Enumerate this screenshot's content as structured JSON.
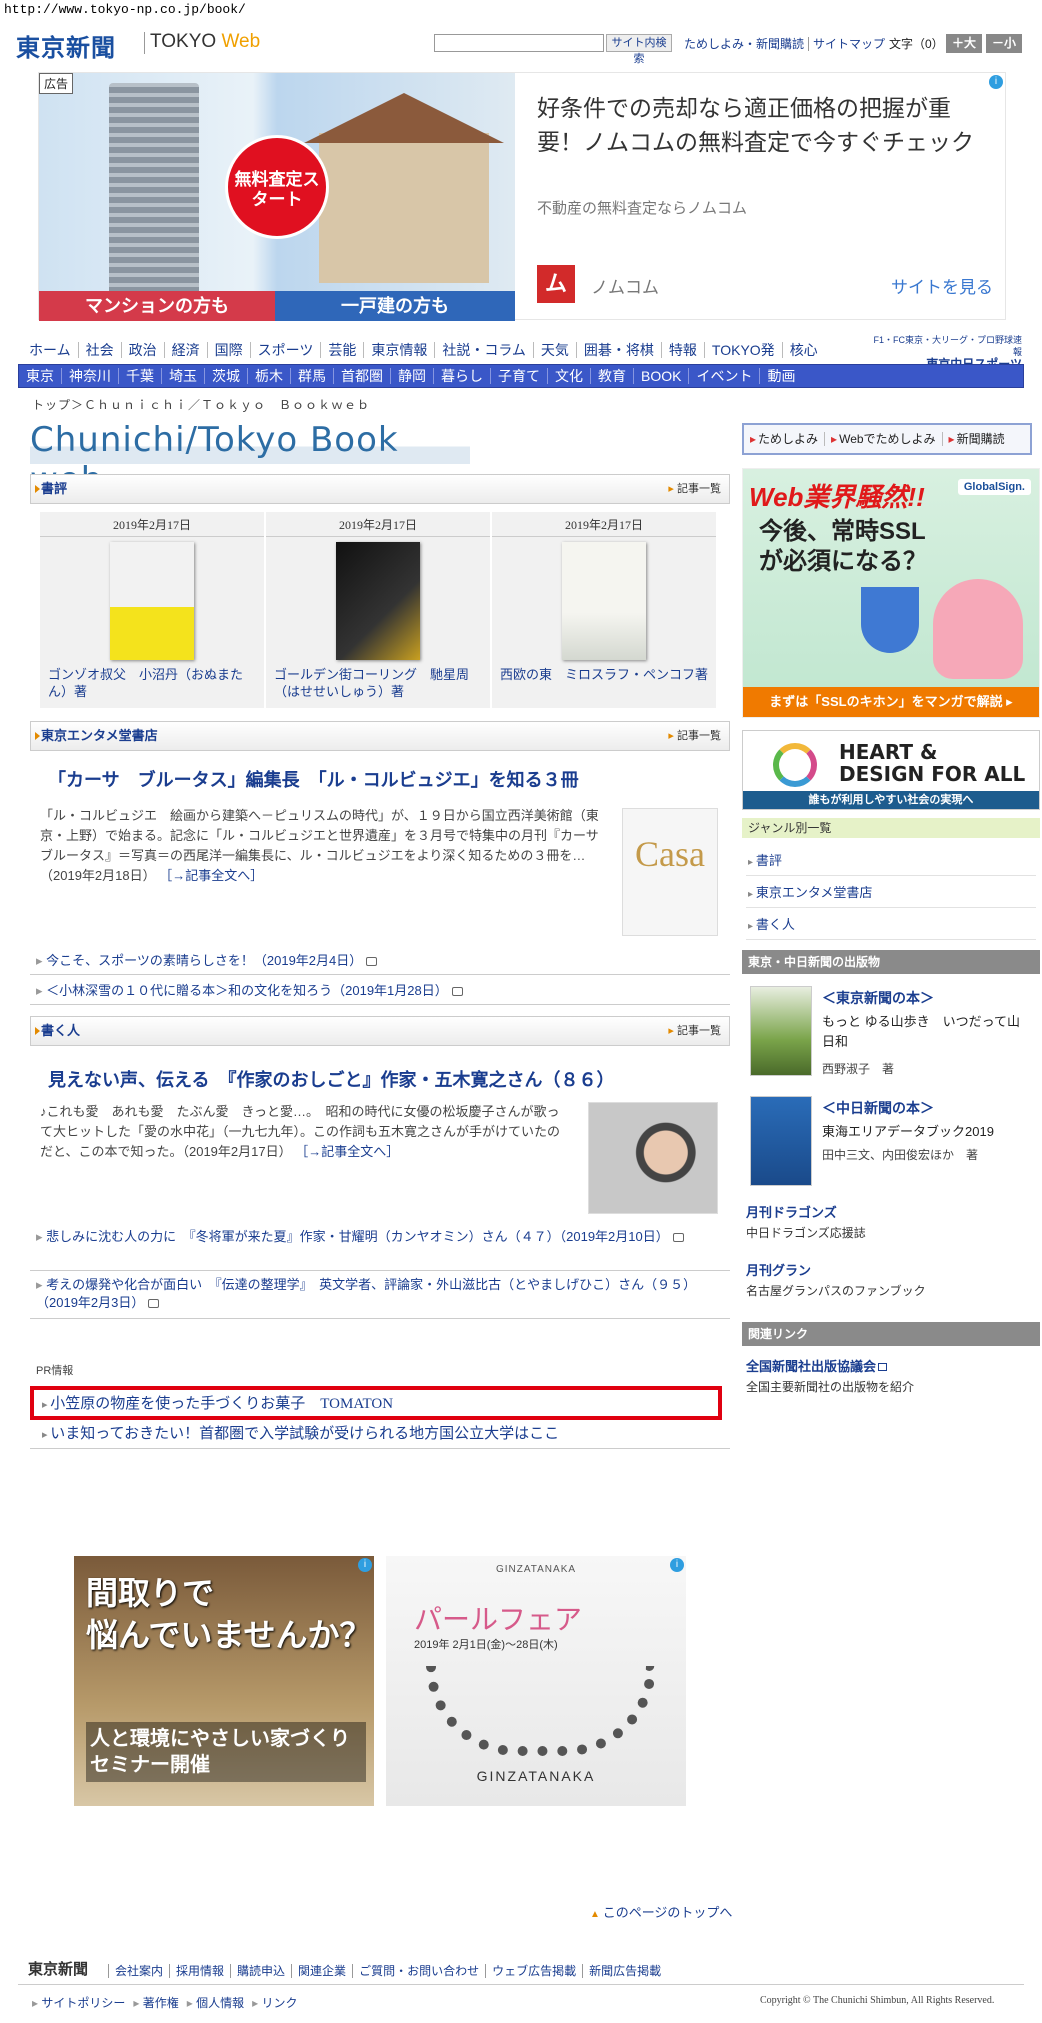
{
  "url": "http://www.tokyo-np.co.jp/book/",
  "header": {
    "logo": "東京新聞",
    "logo_web_prefix": "TOKYO",
    "logo_web_suffix": "Web",
    "search_button": "サイト内検索",
    "links": [
      "ためしよみ・新聞購読",
      "サイトマップ"
    ],
    "text_size_label": "文字（0）",
    "size_up": "＋大",
    "size_down": "－小"
  },
  "top_ad": {
    "tag": "広告",
    "badge": "無料査定スタート",
    "label_left": "マンションの方も",
    "label_right": "一戸建の方も",
    "headline": "好条件での売却なら適正価格の把握が重要！ノムコムの無料査定で今すぐチェック",
    "sub": "不動産の無料査定ならノムコム",
    "brand_icon": "ム",
    "brand": "ノムコム",
    "cta": "サイトを見る"
  },
  "nav_main": [
    "ホーム",
    "社会",
    "政治",
    "経済",
    "国際",
    "スポーツ",
    "芸能",
    "東京情報",
    "社説・コラム",
    "天気",
    "囲碁・将棋",
    "特報",
    "TOKYO発",
    "核心"
  ],
  "chunichi_sports": {
    "line1": "F1・FC東京・大リーグ・プロ野球速報",
    "line2": "東京中日スポーツ"
  },
  "nav_region": [
    "東京",
    "神奈川",
    "千葉",
    "埼玉",
    "茨城",
    "栃木",
    "群馬",
    "首都圏",
    "静岡",
    "暮らし",
    "子育て",
    "文化",
    "教育",
    "BOOK",
    "イベント",
    "動画"
  ],
  "breadcrumb": "トップ＞Ｃｈｕｎｉｃｈｉ／Ｔｏｋｙｏ　Ｂｏｏｋｗｅｂ",
  "page_title": "Chunichi/Tokyo Book web",
  "section_more": "記事一覧",
  "reviews": {
    "title": "書評",
    "items": [
      {
        "date": "2019年2月17日",
        "caption": "ゴンゾオ叔父　小沼丹（おぬまたん）著"
      },
      {
        "date": "2019年2月17日",
        "caption": "ゴールデン街コーリング　馳星周（はせせいしゅう）著"
      },
      {
        "date": "2019年2月17日",
        "caption": "西欧の東　ミロスラフ・ペンコフ著"
      }
    ]
  },
  "entame": {
    "title": "東京エンタメ堂書店",
    "headline": "「カーサ　ブルータス」編集長　「ル・コルビュジエ」を知る３冊",
    "body": "「ル・コルビュジエ　絵画から建築へ－ピュリスムの時代」が、１９日から国立西洋美術館（東京・上野）で始まる。記念に「ル・コルビュジエと世界遺産」を３月号で特集中の月刊『カーサ　ブルータス』＝写真＝の西尾洋一編集長に、ル・コルビュジエをより深く知るための３冊を…（2019年2月18日）",
    "more": "［→記事全文へ］",
    "thumb": "Casa",
    "links": [
      "今こそ、スポーツの素晴らしさを！（2019年2月4日）",
      "＜小林深雪の１０代に贈る本＞和の文化を知ろう（2019年1月28日）"
    ]
  },
  "writers": {
    "title": "書く人",
    "headline": "見えない声、伝える　『作家のおしごと』作家・五木寛之さん（８６）",
    "body": "♪これも愛　あれも愛　たぶん愛　きっと愛…。　昭和の時代に女優の松坂慶子さんが歌って大ヒットした「愛の水中花」（一九七九年）。この作詞も五木寛之さんが手がけていたのだと、この本で知った。（2019年2月17日）",
    "more": "［→記事全文へ］",
    "links": [
      "悲しみに沈む人の力に　『冬将軍が来た夏』作家・甘耀明（カンヤオミン）さん（４７）（2019年2月10日）",
      "考えの爆発や化合が面白い　『伝達の整理学』　英文学者、評論家・外山滋比古（とやましげひこ）さん（９５）（2019年2月3日）"
    ]
  },
  "pr": {
    "label": "PR情報",
    "links": [
      "小笠原の物産を使った手づくりお菓子　TOMATON",
      "いま知っておきたい！首都圏で入学試験が受けられる地方国公立大学はここ"
    ]
  },
  "bottom_ads": {
    "a": {
      "line1": "間取りで",
      "line2": "悩んでいませんか？",
      "line3": "人と環境にやさしい家づくりセミナー開催"
    },
    "b": {
      "brand_top": "GINZATANAKA",
      "title": "パールフェア",
      "dates": "2019年 2月1日(金)～28日(木)",
      "brand_bottom": "GINZATANAKA"
    }
  },
  "page_top": "このページのトップへ",
  "footer": {
    "logo": "東京新聞",
    "links": [
      "会社案内",
      "採用情報",
      "購読申込",
      "関連企業",
      "ご質問・お問い合わせ",
      "ウェブ広告掲載",
      "新聞広告掲載"
    ],
    "links2": [
      "サイトポリシー",
      "著作権",
      "個人情報",
      "リンク"
    ],
    "copyright": "Copyright © The Chunichi Shimbun, All Rights Reserved."
  },
  "sidebar": {
    "top_links": [
      "ためしよみ",
      "Webでためしよみ",
      "新聞購読"
    ],
    "ad1": {
      "title": "Web業界騒然!!",
      "body": "今後、常時SSLが必須になる？",
      "brand": "GlobalSign.",
      "footer": "まずは「SSLのキホン」をマンガで解説 ▸"
    },
    "ad2": {
      "title": "HEART & DESIGN FOR ALL",
      "footer": "誰もが利用しやすい社会の実現へ"
    },
    "genre_title": "ジャンル別一覧",
    "genres": [
      "書評",
      "東京エンタメ堂書店",
      "書く人"
    ],
    "pub_title": "東京・中日新聞の出版物",
    "pubs": [
      {
        "category": "＜東京新聞の本＞",
        "title": "もっと ゆる山歩き　いつだって山日和",
        "author": "西野淑子　著"
      },
      {
        "category": "＜中日新聞の本＞",
        "title": "東海エリアデータブック2019",
        "author": "田中三文、内田俊宏ほか　著"
      }
    ],
    "mags": [
      {
        "name": "月刊ドラゴンズ",
        "sub": "中日ドラゴンズ応援誌"
      },
      {
        "name": "月刊グラン",
        "sub": "名古屋グランパスのファンブック"
      }
    ],
    "related_title": "関連リンク",
    "related_link": "全国新聞社出版協議会",
    "related_sub": "全国主要新聞社の出版物を紹介"
  }
}
